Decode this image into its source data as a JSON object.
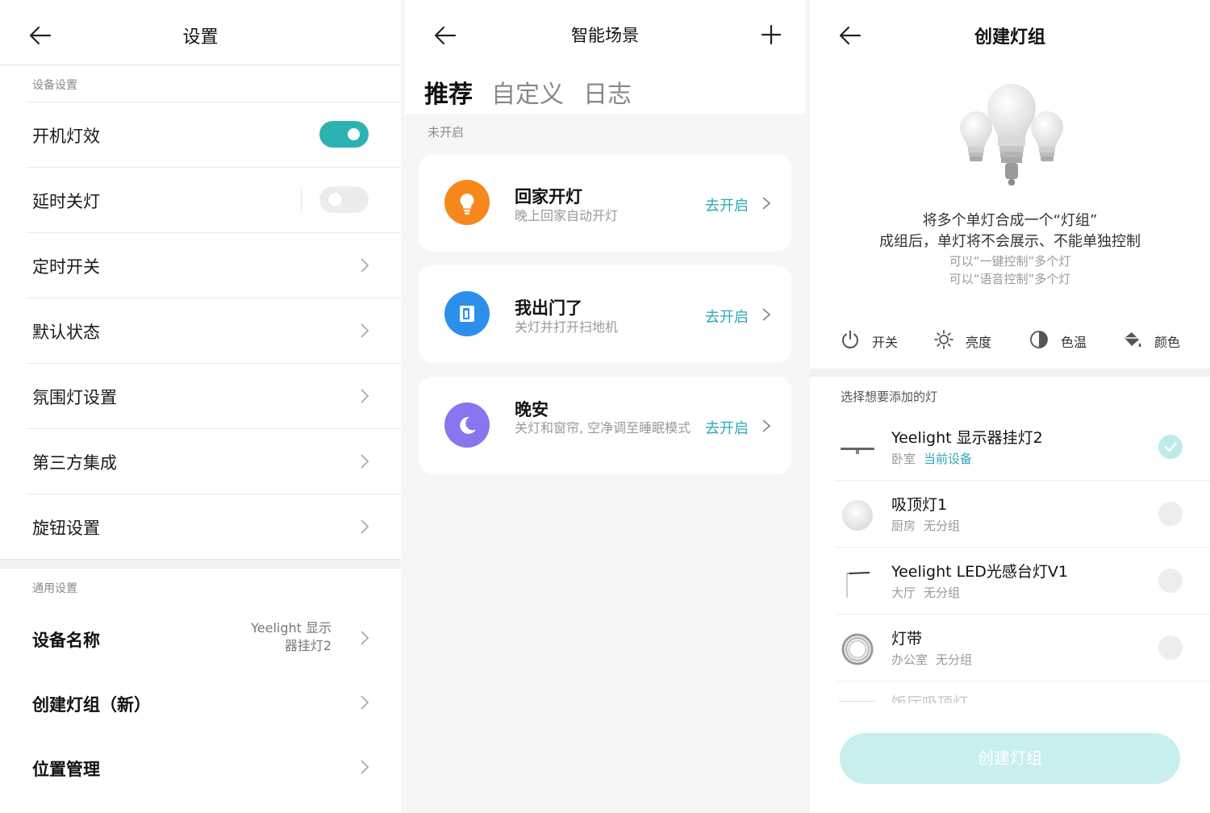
{
  "settings": {
    "title": "设置",
    "device_section": "设备设置",
    "rows": [
      {
        "label": "开机灯效",
        "type": "toggle",
        "on": true
      },
      {
        "label": "延时关灯",
        "type": "toggle",
        "on": false
      },
      {
        "label": "定时开关"
      },
      {
        "label": "默认状态"
      },
      {
        "label": "氛围灯设置"
      },
      {
        "label": "第三方集成"
      },
      {
        "label": "旋钮设置"
      }
    ],
    "general_section": "通用设置",
    "general_rows": [
      {
        "label": "设备名称",
        "value_line1": "Yeelight 显示",
        "value_line2": "器挂灯2"
      },
      {
        "label": "创建灯组（新）"
      },
      {
        "label": "位置管理"
      }
    ]
  },
  "scenes": {
    "title": "智能场景",
    "tabs": [
      {
        "label": "推荐",
        "active": true
      },
      {
        "label": "自定义",
        "active": false
      },
      {
        "label": "日志",
        "active": false
      }
    ],
    "section": "未开启",
    "cards": [
      {
        "title": "回家开灯",
        "desc": "晚上回家自动开灯",
        "action": "去开启",
        "icon": "lightbulb-icon",
        "color": "#f6881b"
      },
      {
        "title": "我出门了",
        "desc": "关灯并打开扫地机",
        "action": "去开启",
        "icon": "door-icon",
        "color": "#2d8fec"
      },
      {
        "title": "晚安",
        "desc": "关灯和窗帘, 空净调至睡眠模式",
        "action": "去开启",
        "icon": "moon-icon",
        "color": "#8a75ee"
      }
    ]
  },
  "group": {
    "title": "创建灯组",
    "intro_line1": "将多个单灯合成一个“灯组”",
    "intro_line2": "成组后，单灯将不会展示、不能单独控制",
    "intro_line3": "可以“一键控制”多个灯",
    "intro_line4": "可以“语音控制”多个灯",
    "features": [
      {
        "label": "开关",
        "icon": "power-icon"
      },
      {
        "label": "亮度",
        "icon": "brightness-icon"
      },
      {
        "label": "色温",
        "icon": "color-temp-icon"
      },
      {
        "label": "颜色",
        "icon": "paint-bucket-icon"
      }
    ],
    "select_label": "选择想要添加的灯",
    "lamps": [
      {
        "name": "Yeelight 显示器挂灯2",
        "room": "卧室",
        "tag": "当前设备",
        "selected": true
      },
      {
        "name": "吸顶灯1",
        "room": "厨房",
        "tag": "无分组",
        "selected": false
      },
      {
        "name": "Yeelight LED光感台灯V1",
        "room": "大厅",
        "tag": "无分组",
        "selected": false
      },
      {
        "name": "灯带",
        "room": "办公室",
        "tag": "无分组",
        "selected": false
      }
    ],
    "partial_item": "饭厅吸顶灯",
    "create_button": "创建灯组"
  },
  "colors": {
    "accent": "#2cb3b1",
    "link": "#2ca9b5",
    "button_disabled": "#c8eeee"
  }
}
